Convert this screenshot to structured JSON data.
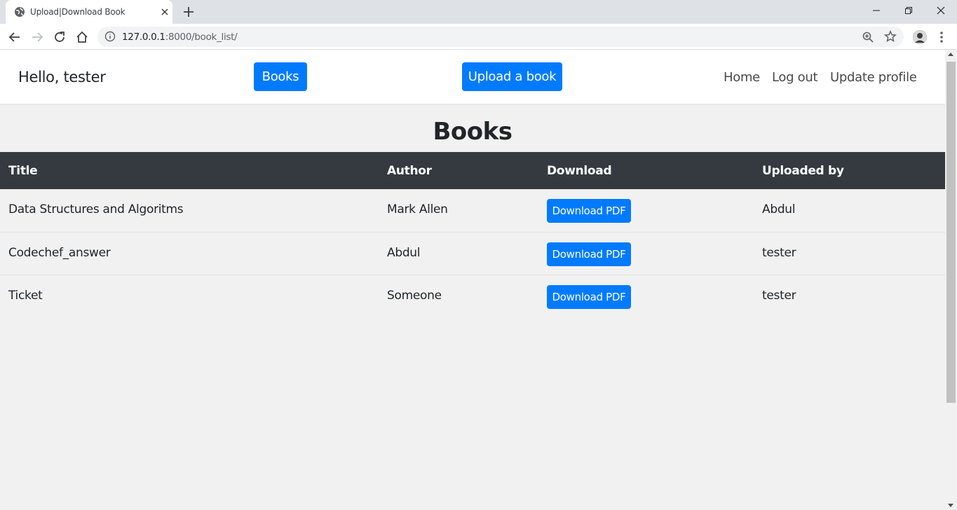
{
  "browser": {
    "tab_title": "Upload|Download Book",
    "url_host": "127.0.0.1",
    "url_rest": ":8000/book_list/"
  },
  "nav": {
    "brand": "Hello, tester",
    "books_button": "Books",
    "upload_button": "Upload a book",
    "home_link": "Home",
    "logout_link": "Log out",
    "profile_link": "Update profile"
  },
  "page": {
    "heading": "Books"
  },
  "table": {
    "headers": [
      "Title",
      "Author",
      "Download",
      "Uploaded by"
    ],
    "rows": [
      {
        "title": "Data Structures and Algoritms",
        "author": "Mark Allen",
        "download": "Download PDF",
        "uploader": "Abdul"
      },
      {
        "title": "Codechef_answer",
        "author": "Abdul",
        "download": "Download PDF",
        "uploader": "tester"
      },
      {
        "title": "Ticket",
        "author": "Someone",
        "download": "Download PDF",
        "uploader": "tester"
      }
    ]
  },
  "colors": {
    "primary": "#007bff",
    "table_header": "#343a40",
    "page_bg": "#f1f1f1"
  }
}
